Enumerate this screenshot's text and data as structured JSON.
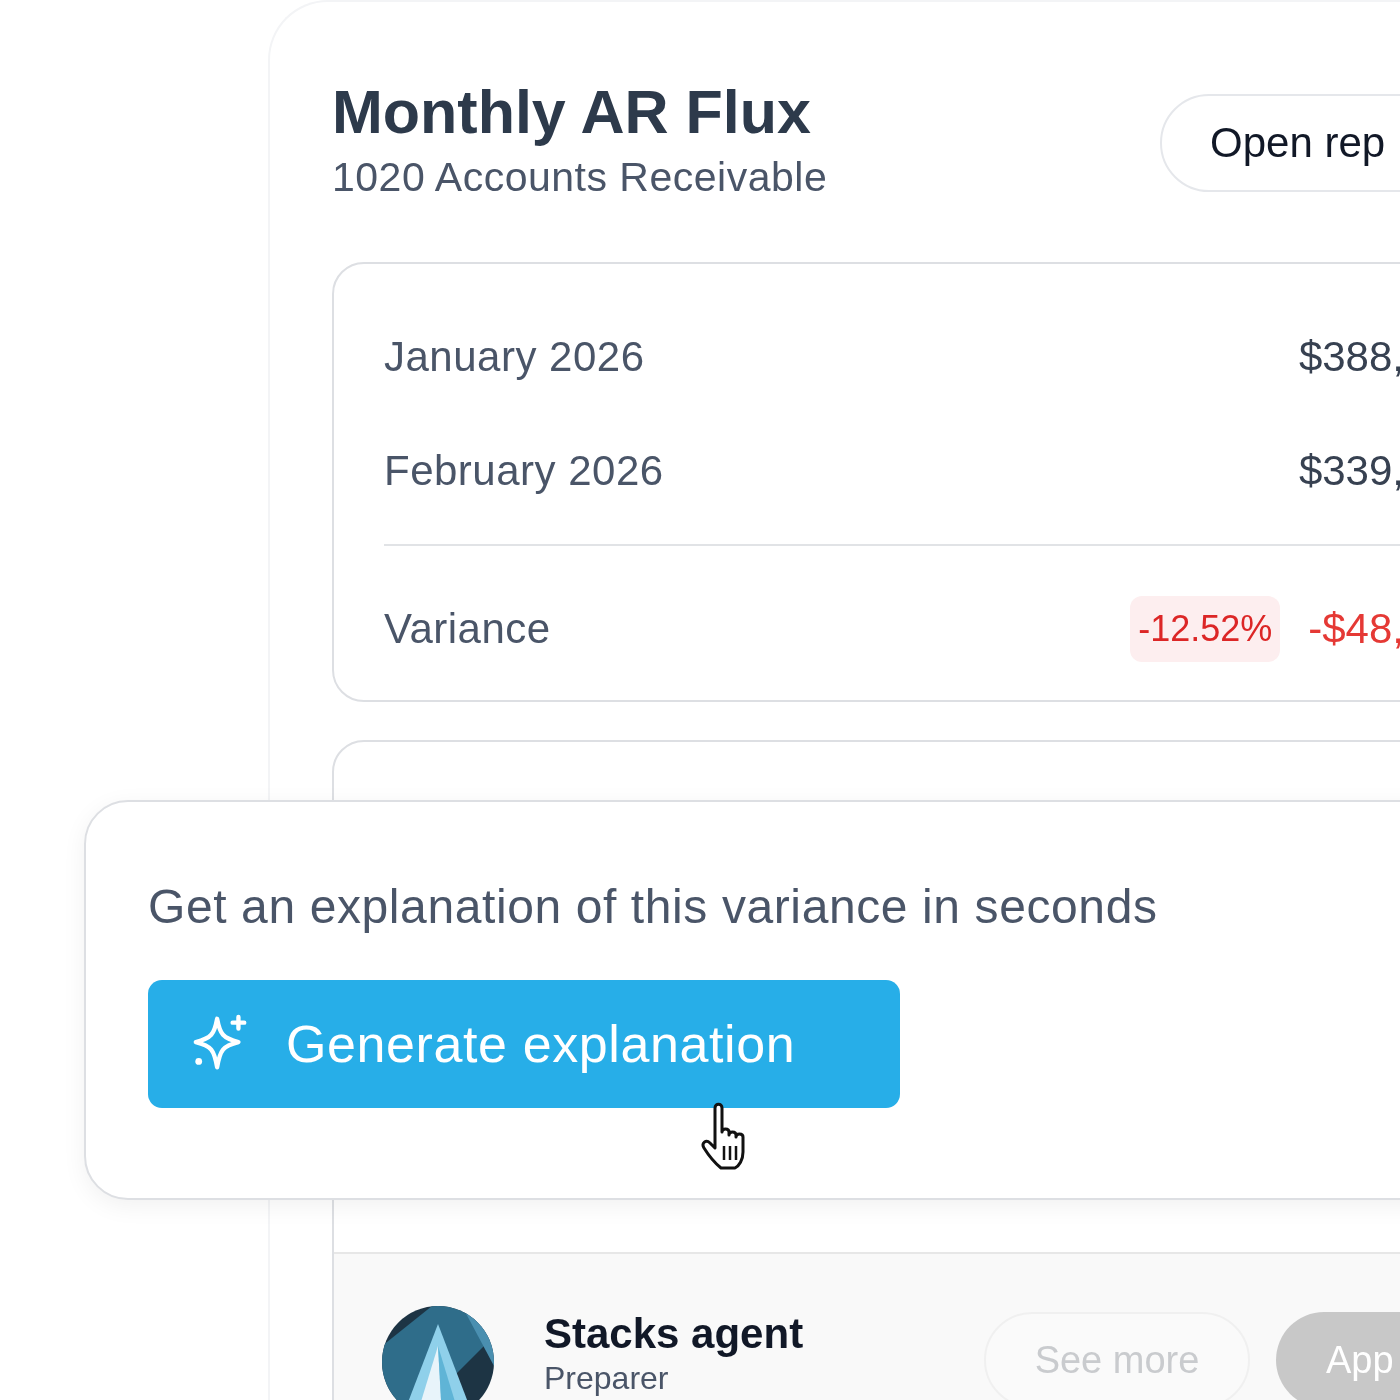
{
  "header": {
    "title": "Monthly AR Flux",
    "subtitle": "1020 Accounts Receivable",
    "open_button": "Open rep"
  },
  "summary": {
    "rows": [
      {
        "label": "January 2026",
        "value": "$388,"
      },
      {
        "label": "February 2026",
        "value": "$339,"
      }
    ],
    "variance": {
      "label": "Variance",
      "percent": "-12.52%",
      "amount": "-$48,"
    }
  },
  "prompt": {
    "text": "Get an explanation of this variance in seconds",
    "button": "Generate explanation"
  },
  "agent": {
    "name": "Stacks agent",
    "role": "Preparer",
    "buttons": [
      {
        "label": "See more",
        "kind": "secondary"
      },
      {
        "label": "App",
        "kind": "primary"
      }
    ]
  }
}
